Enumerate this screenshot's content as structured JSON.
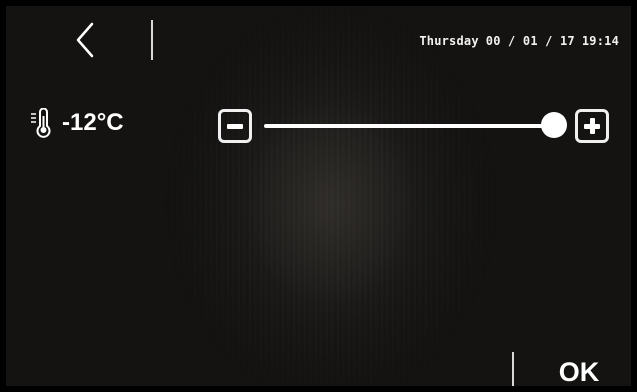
{
  "header": {
    "back_icon": "chevron-left-icon",
    "day": "Thursday",
    "date": "00 / 01 / 17",
    "time": "19:14"
  },
  "setting": {
    "icon": "thermometer-icon",
    "value_label": "-12°C",
    "slider_level_percent": 100,
    "decrease_icon": "minus-icon",
    "increase_icon": "plus-icon"
  },
  "footer": {
    "ok_label": "OK"
  },
  "colors": {
    "background": "#141312",
    "foreground": "#ffffff",
    "frame": "#000000"
  }
}
